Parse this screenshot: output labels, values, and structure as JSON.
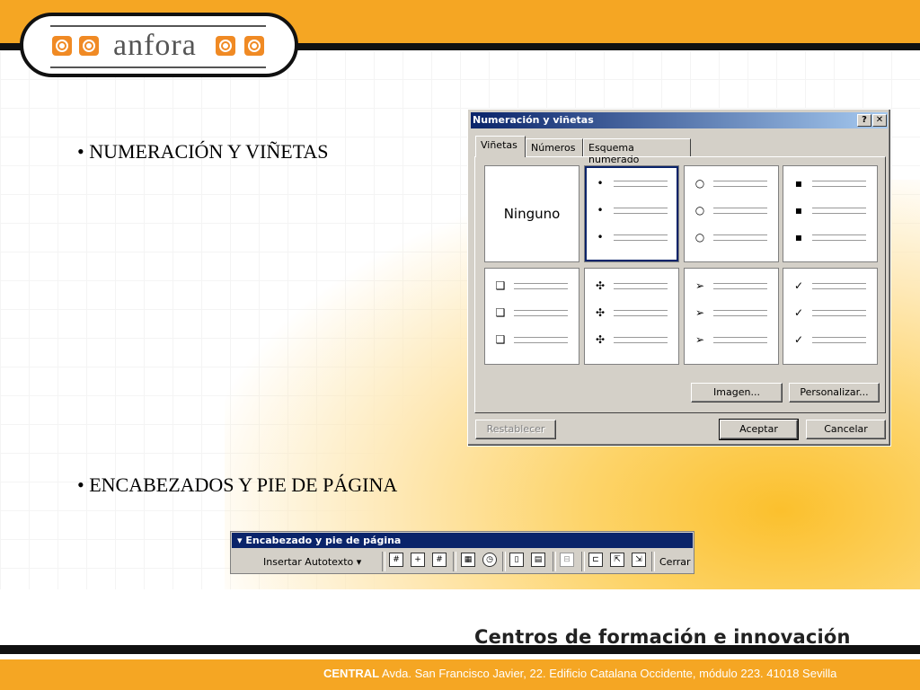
{
  "logo": {
    "text": "anfora"
  },
  "bullets": [
    {
      "text": "• NUMERACIÓN Y VIÑETAS"
    },
    {
      "text": "•  ENCABEZADOS Y PIE DE PÁGINA"
    }
  ],
  "dialog": {
    "title": "Numeración y viñetas",
    "help_btn": "?",
    "close_btn": "✕",
    "tabs": [
      {
        "label": "Viñetas"
      },
      {
        "label": "Números"
      },
      {
        "label": "Esquema numerado"
      }
    ],
    "none_label": "Ninguno",
    "markers": [
      "•",
      "○",
      "▪",
      "❑",
      "✣",
      "➢",
      "✓"
    ],
    "buttons": {
      "image": "Imagen...",
      "customize": "Personalizar...",
      "reset": "Restablecer",
      "accept": "Aceptar",
      "cancel": "Cancelar"
    }
  },
  "toolbar": {
    "title": "▾ Encabezado y pie de página",
    "insert_autotext": "Insertar Autotexto ▾",
    "close": "Cerrar",
    "icons": [
      "#",
      "+",
      "#",
      "▦",
      "◷",
      "▯",
      "▤",
      "⊟",
      "⊏",
      "⇱",
      "⇲"
    ]
  },
  "footer": {
    "title": "Centros de formación e innovación",
    "addr_bold": "CENTRAL",
    "addr": " Avda. San Francisco Javier, 22. Edificio Catalana Occidente, módulo 223. 41018 Sevilla"
  }
}
